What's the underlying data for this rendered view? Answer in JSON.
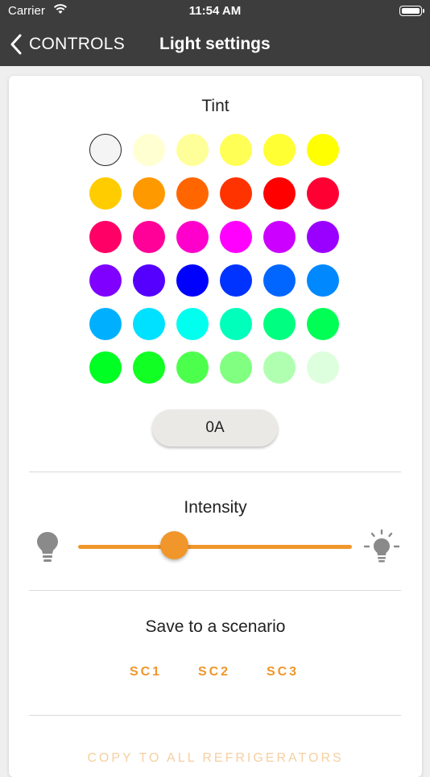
{
  "status_bar": {
    "carrier": "Carrier",
    "time": "11:54 AM"
  },
  "nav": {
    "back_label": "CONTROLS",
    "title": "Light settings"
  },
  "tint": {
    "title": "Tint",
    "selected_index": 0,
    "swatches": [
      "#f4f4f4",
      "#ffffd2",
      "#ffff99",
      "#ffff55",
      "#ffff33",
      "#ffff00",
      "#ffcc00",
      "#ff9900",
      "#ff6600",
      "#ff3300",
      "#ff0000",
      "#ff0033",
      "#ff0066",
      "#ff0099",
      "#ff00cc",
      "#ff00ff",
      "#cc00ff",
      "#9900ff",
      "#7f00ff",
      "#5500ff",
      "#0000ff",
      "#0033ff",
      "#0066ff",
      "#0088ff",
      "#00b0ff",
      "#00e0ff",
      "#00ffee",
      "#00ffbb",
      "#00ff80",
      "#00ff55",
      "#00ff22",
      "#11ff22",
      "#4dff4d",
      "#80ff80",
      "#b0ffb0",
      "#ddffdd"
    ],
    "code_button": "0A"
  },
  "intensity": {
    "title": "Intensity",
    "value_fraction": 0.35
  },
  "scenario": {
    "title": "Save to a scenario",
    "buttons": [
      "SC1",
      "SC2",
      "SC3"
    ]
  },
  "copy_label": "COPY TO ALL REFRIGERATORS",
  "colors": {
    "accent": "#f0962a",
    "bar": "#3d3d3d"
  }
}
